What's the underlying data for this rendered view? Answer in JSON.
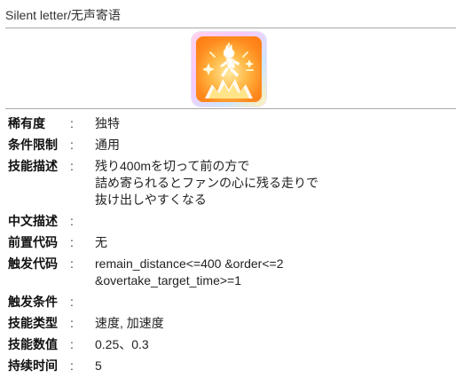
{
  "page": {
    "title": "Silent letter/无声寄语"
  },
  "skill": {
    "icon_name": "sprinting-figure-icon",
    "rarity_label": "稀有度",
    "rarity_value": "独特",
    "condition_limit_label": "条件限制",
    "condition_limit_value": "通用",
    "description_label": "技能描述",
    "description_value": "残り400mを切って前の方で\n詰め寄られるとファンの心に残る走りで\n抜け出しやすくなる",
    "chinese_desc_label": "中文描述",
    "chinese_desc_value": "",
    "prereq_code_label": "前置代码",
    "prereq_code_value": "无",
    "trigger_code_label": "触发代码",
    "trigger_code_value": "remain_distance<=400 &order<=2\n&overtake_target_time>=1",
    "trigger_condition_label": "触发条件",
    "trigger_condition_value": "",
    "skill_type_label": "技能类型",
    "skill_type_value": "速度, 加速度",
    "skill_values_label": "技能数值",
    "skill_values_value": "0.25、0.3",
    "duration_label": "持续时间",
    "duration_value": "5",
    "colon": ":"
  }
}
